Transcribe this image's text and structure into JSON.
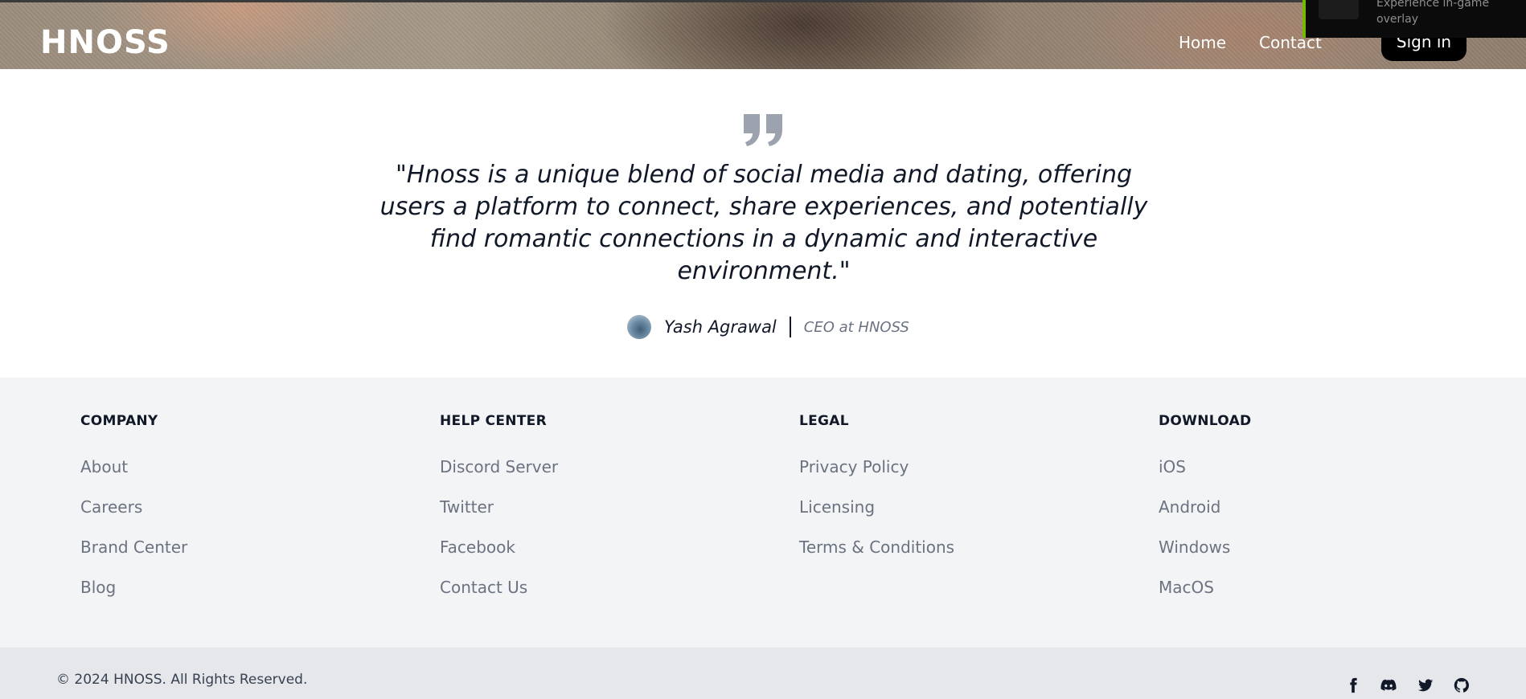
{
  "header": {
    "logo": "HNOSS",
    "nav": {
      "home": "Home",
      "contact": "Contact",
      "signin": "Sign in"
    },
    "overlay_text": "Experience in-game overlay"
  },
  "testimonial": {
    "quote": "\"Hnoss is a unique blend of social media and dating, offering users a platform to connect, share experiences, and potentially find romantic connections in a dynamic and interactive environment.\"",
    "author": "Yash Agrawal",
    "role": "CEO at HNOSS"
  },
  "footer": {
    "columns": [
      {
        "title": "COMPANY",
        "links": [
          "About",
          "Careers",
          "Brand Center",
          "Blog"
        ]
      },
      {
        "title": "HELP CENTER",
        "links": [
          "Discord Server",
          "Twitter",
          "Facebook",
          "Contact Us"
        ]
      },
      {
        "title": "LEGAL",
        "links": [
          "Privacy Policy",
          "Licensing",
          "Terms & Conditions"
        ]
      },
      {
        "title": "DOWNLOAD",
        "links": [
          "iOS",
          "Android",
          "Windows",
          "MacOS"
        ]
      }
    ],
    "copyright": "© 2024 HNOSS. All Rights Reserved.",
    "social_icons": [
      "facebook-icon",
      "discord-icon",
      "twitter-icon",
      "github-icon"
    ]
  },
  "colors": {
    "brand_dark": "#000000",
    "footer_bg": "#f3f4f6",
    "bottom_bar_bg": "#e5e7eb",
    "link_gray": "#6b7280",
    "overlay_accent": "#76b900"
  }
}
